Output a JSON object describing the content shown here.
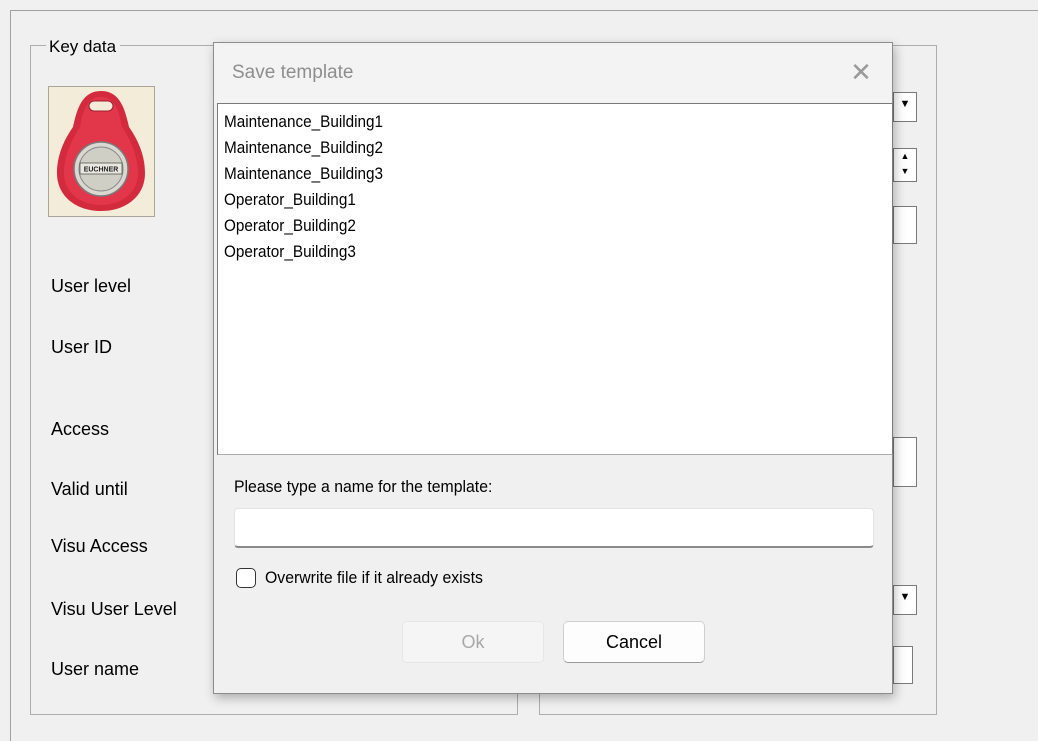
{
  "window": {
    "group_key_data": "Key data",
    "labels": [
      "User level",
      "User ID",
      "Access",
      "Valid until",
      "Visu Access",
      "Visu User Level",
      "User name"
    ],
    "key_image": {
      "brand_text": "EUCHNER",
      "fob_color": "#d42a3e"
    }
  },
  "dialog": {
    "title": "Save template",
    "close_icon": "close-icon",
    "templates": [
      "Maintenance_Building1",
      "Maintenance_Building2",
      "Maintenance_Building3",
      "Operator_Building1",
      "Operator_Building2",
      "Operator_Building3"
    ],
    "prompt": "Please type a name for the template:",
    "name_value": "",
    "overwrite_label": "Overwrite file if it already exists",
    "overwrite_checked": false,
    "ok_label": "Ok",
    "ok_enabled": false,
    "cancel_label": "Cancel"
  }
}
